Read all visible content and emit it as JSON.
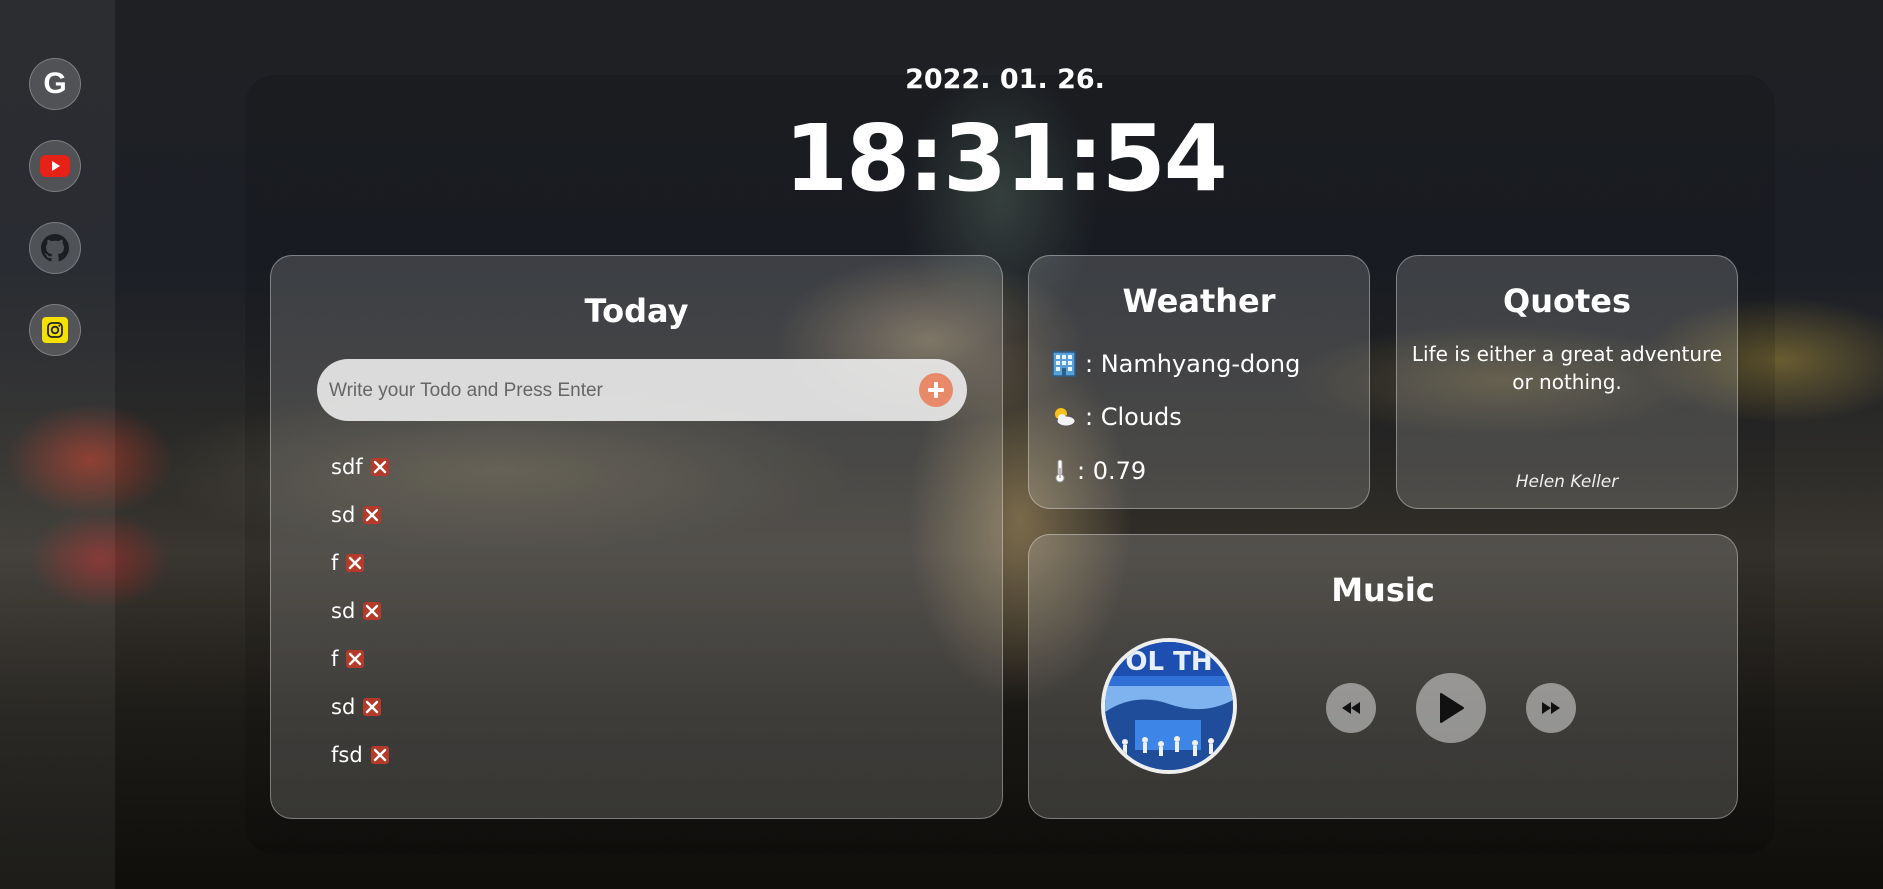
{
  "sidebar": {
    "links": [
      {
        "name": "google",
        "icon": "google-icon",
        "label": "G"
      },
      {
        "name": "youtube",
        "icon": "youtube-icon",
        "color": "#e62117"
      },
      {
        "name": "github",
        "icon": "github-icon"
      },
      {
        "name": "instagram",
        "icon": "instagram-icon",
        "color": "#f5e100"
      }
    ]
  },
  "header": {
    "date": "2022. 01. 26.",
    "time": "18:31:54"
  },
  "todo": {
    "title": "Today",
    "input_placeholder": "Write your Todo and Press Enter",
    "add_icon": "plus-circle-icon",
    "add_color": "#e8896a",
    "delete_icon": "close-x-icon",
    "items": [
      "sdf",
      "sd",
      "f",
      "sd",
      "f",
      "sd",
      "fsd"
    ]
  },
  "weather": {
    "title": "Weather",
    "location_icon": "building-icon",
    "location": ": Namhyang-dong",
    "condition_icon": "clouds-icon",
    "condition": ": Clouds",
    "temp_icon": "thermometer-icon",
    "temperature": ": 0.79"
  },
  "quotes": {
    "title": "Quotes",
    "text": "Life is either a great adventure or nothing.",
    "author": "Helen Keller"
  },
  "music": {
    "title": "Music",
    "album_icon": "album-cover",
    "controls": [
      "rewind-icon",
      "play-icon",
      "fast-forward-icon"
    ]
  }
}
